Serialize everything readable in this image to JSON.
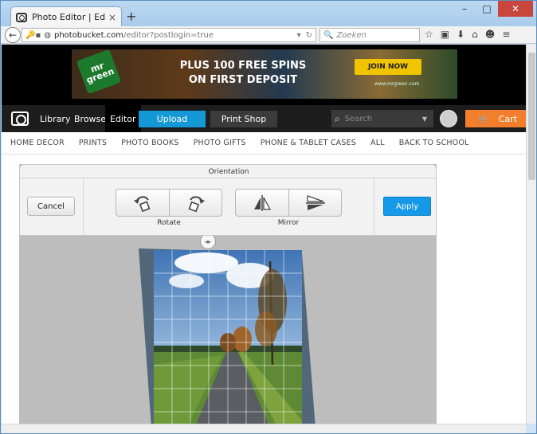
{
  "browser": {
    "tab_title": "Photo Editor | Edit photos, ...",
    "tab_close": "×",
    "new_tab": "+",
    "window_buttons": {
      "minimize": "–",
      "maximize": "□",
      "close": "✕"
    },
    "url_host": "photobucket.com",
    "url_path": "/editor?postlogin=true",
    "search_placeholder": "Zoeken",
    "icons": [
      "back-icon",
      "key-icon",
      "star-icon",
      "clipboard-icon",
      "download-icon",
      "home-icon",
      "chat-icon",
      "menu-icon"
    ]
  },
  "ad": {
    "logo_text": "mr green",
    "headline": "PLUS 100 FREE SPINS ON FIRST DEPOSIT",
    "cta": "JOIN NOW",
    "url": "www.mrgreen.com"
  },
  "mainnav": {
    "library": "Library",
    "browse": "Browse",
    "editor": "Editor",
    "upload": "Upload",
    "print_shop": "Print Shop",
    "search_placeholder": "Search",
    "cart": "Cart"
  },
  "categories": [
    "HOME DECOR",
    "PRINTS",
    "PHOTO BOOKS",
    "PHOTO GIFTS",
    "PHONE & TABLET CASES",
    "ALL",
    "BACK TO SCHOOL"
  ],
  "editor": {
    "panel_title": "Orientation",
    "cancel": "Cancel",
    "apply": "Apply",
    "rotate_label": "Rotate",
    "mirror_label": "Mirror",
    "straighten_handle": "◂▸"
  },
  "colors": {
    "accent_blue": "#1599d6",
    "cart_orange": "#f37f2d",
    "nav_dark": "#1d1d1d"
  }
}
